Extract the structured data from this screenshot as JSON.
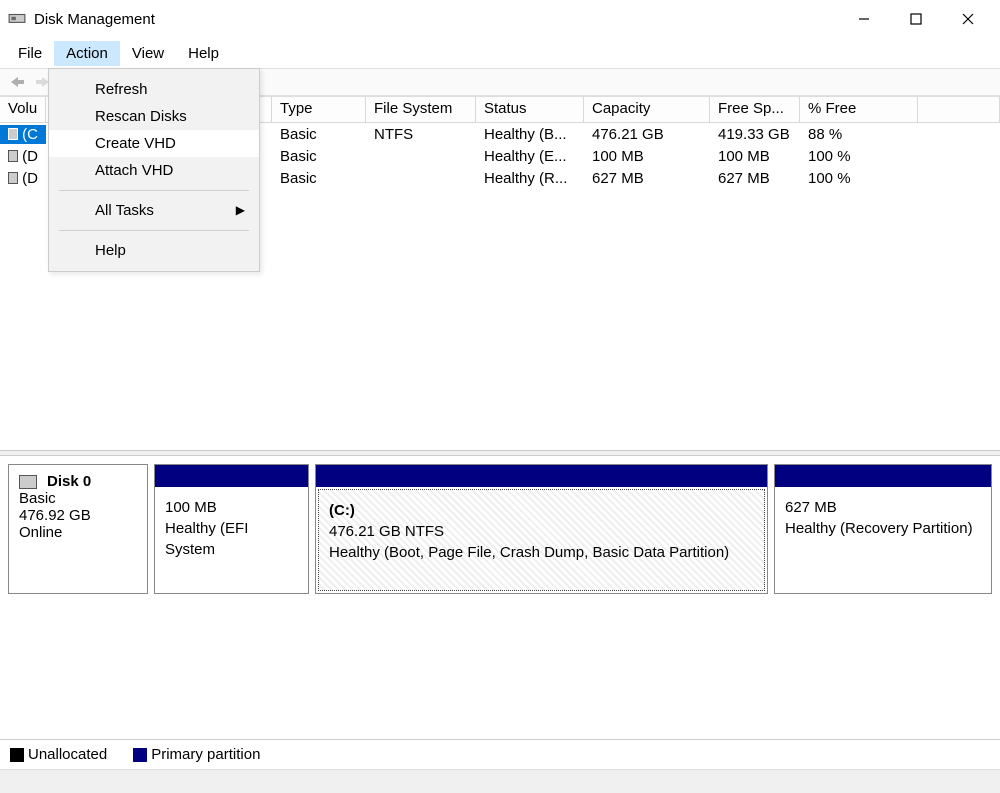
{
  "window": {
    "title": "Disk Management"
  },
  "menubar": {
    "file": "File",
    "action": "Action",
    "view": "View",
    "help": "Help"
  },
  "dropdown": {
    "refresh": "Refresh",
    "rescan": "Rescan Disks",
    "create_vhd": "Create VHD",
    "attach_vhd": "Attach VHD",
    "all_tasks": "All Tasks",
    "help": "Help"
  },
  "columns": {
    "volume": "Volu",
    "type": "Type",
    "fs": "File System",
    "status": "Status",
    "capacity": "Capacity",
    "free": "Free Sp...",
    "pct": "% Free"
  },
  "volumes": [
    {
      "vol": "(C",
      "type": "Basic",
      "fs": "NTFS",
      "status": "Healthy (B...",
      "cap": "476.21 GB",
      "free": "419.33 GB",
      "pct": "88 %"
    },
    {
      "vol": "(D",
      "type": "Basic",
      "fs": "",
      "status": "Healthy (E...",
      "cap": "100 MB",
      "free": "100 MB",
      "pct": "100 %"
    },
    {
      "vol": "(D",
      "type": "Basic",
      "fs": "",
      "status": "Healthy (R...",
      "cap": "627 MB",
      "free": "627 MB",
      "pct": "100 %"
    }
  ],
  "disk": {
    "name": "Disk 0",
    "type": "Basic",
    "size": "476.92 GB",
    "state": "Online",
    "parts": [
      {
        "title": "",
        "size": "100 MB",
        "desc": "Healthy (EFI System"
      },
      {
        "title": "(C:)",
        "size": "476.21 GB NTFS",
        "desc": "Healthy (Boot, Page File, Crash Dump, Basic Data Partition)"
      },
      {
        "title": "",
        "size": "627 MB",
        "desc": "Healthy (Recovery Partition)"
      }
    ]
  },
  "legend": {
    "unallocated": "Unallocated",
    "primary": "Primary partition"
  }
}
